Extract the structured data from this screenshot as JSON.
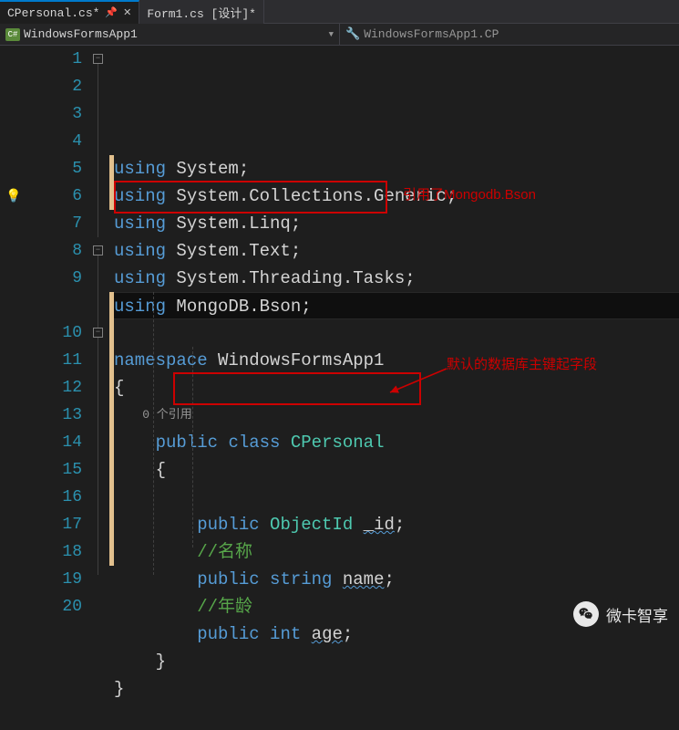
{
  "tabs": [
    {
      "label": "CPersonal.cs*",
      "active": true
    },
    {
      "label": "Form1.cs [设计]*",
      "active": false
    }
  ],
  "nav": {
    "left": {
      "icon_label": "C#",
      "text": "WindowsFormsApp1"
    },
    "right": {
      "text": "WindowsFormsApp1.CP"
    }
  },
  "code": {
    "references_label": "0 个引用",
    "lines": [
      {
        "n": 1,
        "tokens": [
          [
            "kw",
            "using"
          ],
          [
            "str",
            " System;"
          ]
        ]
      },
      {
        "n": 2,
        "tokens": [
          [
            "kw",
            "using"
          ],
          [
            "str",
            " System.Collections.Generic;"
          ]
        ]
      },
      {
        "n": 3,
        "tokens": [
          [
            "kw",
            "using"
          ],
          [
            "str",
            " System.Linq;"
          ]
        ]
      },
      {
        "n": 4,
        "tokens": [
          [
            "kw",
            "using"
          ],
          [
            "str",
            " System.Text;"
          ]
        ]
      },
      {
        "n": 5,
        "tokens": [
          [
            "kw",
            "using"
          ],
          [
            "str",
            " System.Threading.Tasks;"
          ]
        ]
      },
      {
        "n": 6,
        "tokens": [
          [
            "kw",
            "using"
          ],
          [
            "str",
            " MongoDB.Bson;"
          ]
        ],
        "current": true
      },
      {
        "n": 7,
        "tokens": []
      },
      {
        "n": 8,
        "tokens": [
          [
            "kw",
            "namespace"
          ],
          [
            "str",
            " WindowsFormsApp1"
          ]
        ]
      },
      {
        "n": 9,
        "tokens": [
          [
            "str",
            "{"
          ]
        ]
      },
      {
        "n": 10,
        "indent": 1,
        "tokens": [
          [
            "kw",
            "public"
          ],
          [
            "str",
            " "
          ],
          [
            "kw",
            "class"
          ],
          [
            "str",
            " "
          ],
          [
            "type",
            "CPersonal"
          ]
        ]
      },
      {
        "n": 11,
        "indent": 1,
        "tokens": [
          [
            "str",
            "{"
          ]
        ]
      },
      {
        "n": 12,
        "indent": 1,
        "tokens": []
      },
      {
        "n": 13,
        "indent": 2,
        "tokens": [
          [
            "kw",
            "public"
          ],
          [
            "str",
            " "
          ],
          [
            "type",
            "ObjectId"
          ],
          [
            "str",
            " "
          ],
          [
            "sq",
            "_id"
          ],
          [
            "str",
            ";"
          ]
        ]
      },
      {
        "n": 14,
        "indent": 2,
        "tokens": [
          [
            "comment",
            "//名称"
          ]
        ]
      },
      {
        "n": 15,
        "indent": 2,
        "tokens": [
          [
            "kw",
            "public"
          ],
          [
            "str",
            " "
          ],
          [
            "kw",
            "string"
          ],
          [
            "str",
            " "
          ],
          [
            "sq",
            "name"
          ],
          [
            "str",
            ";"
          ]
        ]
      },
      {
        "n": 16,
        "indent": 2,
        "tokens": [
          [
            "comment",
            "//年龄"
          ]
        ]
      },
      {
        "n": 17,
        "indent": 2,
        "tokens": [
          [
            "kw",
            "public"
          ],
          [
            "str",
            " "
          ],
          [
            "kw",
            "int"
          ],
          [
            "str",
            " "
          ],
          [
            "sq",
            "age"
          ],
          [
            "str",
            ";"
          ]
        ]
      },
      {
        "n": 18,
        "indent": 1,
        "tokens": [
          [
            "str",
            "}"
          ]
        ]
      },
      {
        "n": 19,
        "tokens": [
          [
            "str",
            "}"
          ]
        ]
      },
      {
        "n": 20,
        "tokens": []
      }
    ]
  },
  "annotations": {
    "anno1": "引用了Mongodb.Bson",
    "anno2": "默认的数据库主键起字段"
  },
  "watermark": "微卡智享"
}
